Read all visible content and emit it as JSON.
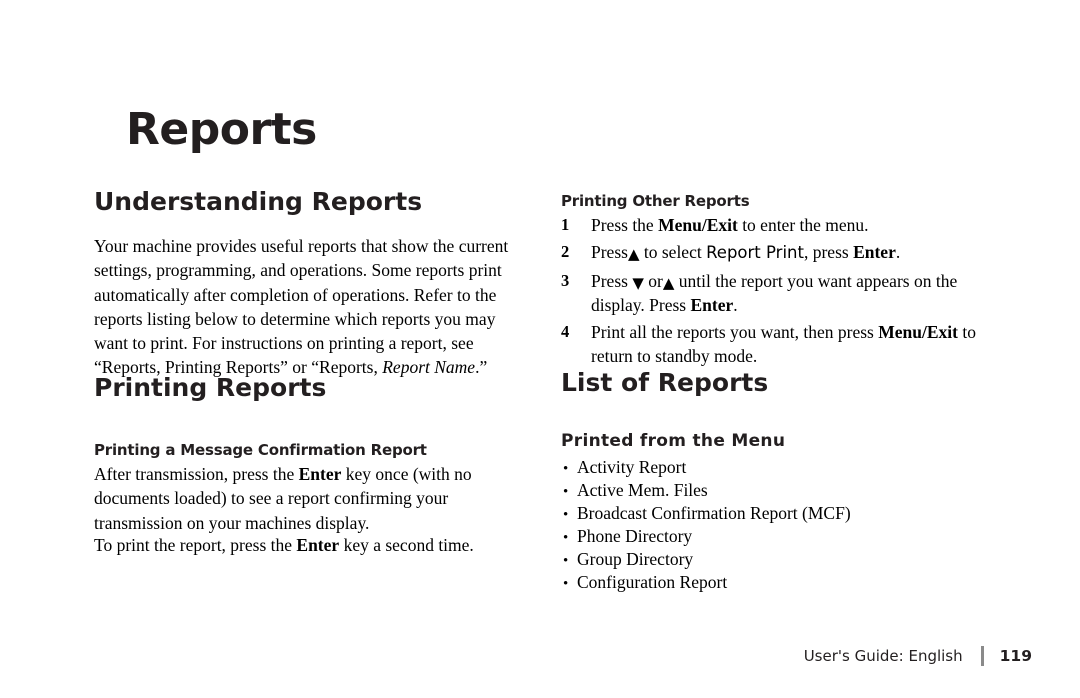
{
  "page": {
    "title": "Reports",
    "page_number": "119",
    "footer_label": "User's Guide:  English"
  },
  "left_column": {
    "section1": {
      "heading": "Understanding Reports",
      "paragraph_line1": "Your machine provides useful reports that show the current",
      "paragraph_line2": "settings, programming, and operations. Some reports print",
      "paragraph_line3": "automatically after completion of operations. Refer to the",
      "paragraph_line4": "reports listing below to determine which reports you may",
      "paragraph_line5": "want to print.  For instructions on printing a report, see",
      "paragraph_line6_pre": "“Reports, Printing Reports” or “Reports, ",
      "paragraph_line6_italic": "Report Name",
      "paragraph_line6_post": ".”"
    },
    "section2": {
      "heading": "Printing Reports",
      "subheading": "Printing a Message Confirmation Report",
      "para1_a": "After transmission, press the ",
      "para1_key": "Enter",
      "para1_b": " key once (with no",
      "para1_line2": "documents loaded) to see a report confirming your",
      "para1_line3": "transmission on your machines display.",
      "para2_a": "To print the report, press the ",
      "para2_key": "Enter",
      "para2_b": " key a second time."
    }
  },
  "right_column": {
    "section1": {
      "subheading": "Printing Other Reports",
      "steps": [
        {
          "num": "1",
          "a": "Press the ",
          "key1": "Menu/Exit",
          "b": " to enter the menu."
        },
        {
          "num": "2",
          "a": "Press",
          "arrow_up": "▲",
          "b": " to select ",
          "display": "Report Print",
          "c": ", press ",
          "key1": "Enter",
          "d": "."
        },
        {
          "num": "3",
          "a": "Press ",
          "arrow_down": "▼",
          "b": " or",
          "arrow_up": "▲",
          "c": " until the report you want appears on the display.  Press ",
          "key1": "Enter",
          "d": "."
        },
        {
          "num": "4",
          "a": "Print all the reports you want, then press ",
          "key1": "Menu/Exit",
          "b": " to return to standby mode."
        }
      ]
    },
    "section2": {
      "heading": "List of Reports",
      "subheading": "Printed from the Menu",
      "bullet_marker": "•",
      "items": [
        "Activity  Report",
        "Active Mem. Files",
        "Broadcast Confirmation Report (MCF)",
        "Phone Directory",
        "Group Directory",
        "Configuration  Report"
      ]
    }
  }
}
